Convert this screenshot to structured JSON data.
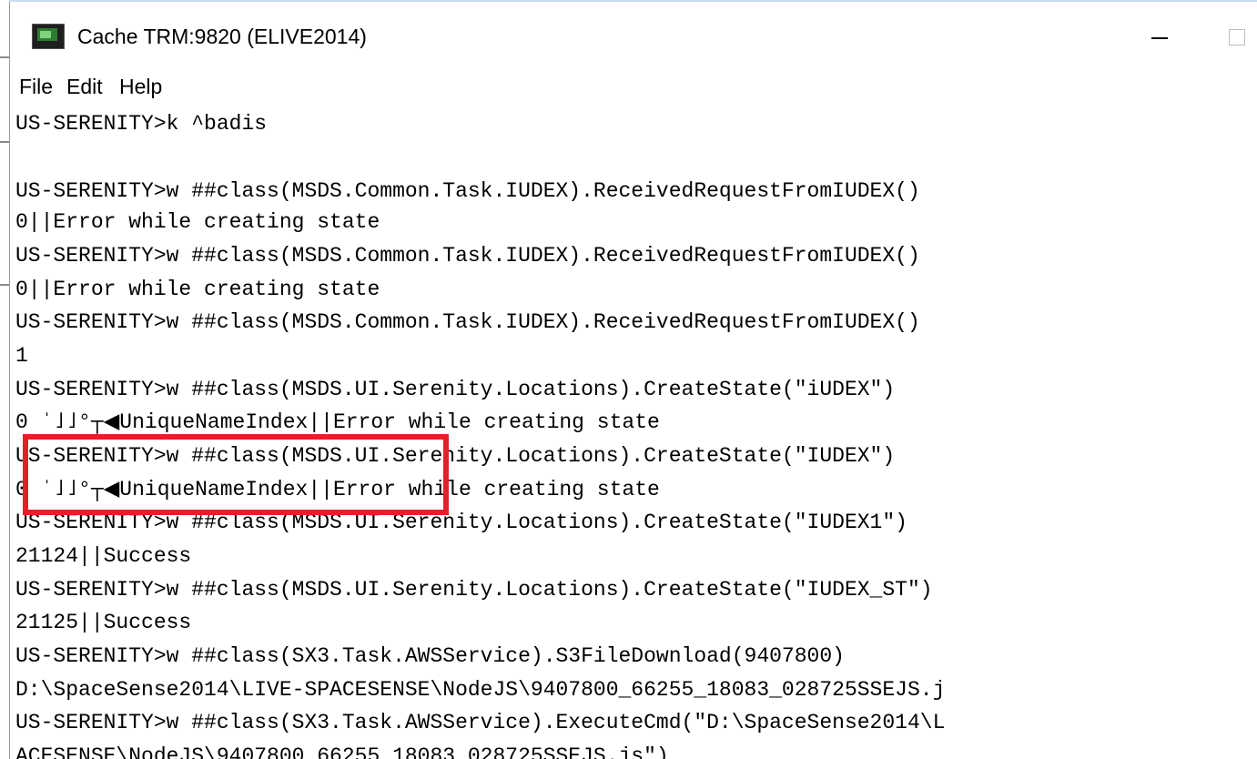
{
  "window": {
    "title": "Cache TRM:9820 (ELIVE2014)",
    "icon": "terminal-app-icon",
    "controls": {
      "minimize": "minimize-icon",
      "maximize": "maximize-icon"
    }
  },
  "menu": {
    "items": [
      {
        "label": "File"
      },
      {
        "label": "Edit"
      },
      {
        "label": "Help"
      }
    ]
  },
  "console": {
    "lines": [
      "US-SERENITY>k ^badis",
      "",
      "US-SERENITY>w ##class(MSDS.Common.Task.IUDEX).ReceivedRequestFromIUDEX()",
      "0||Error while creating state",
      "US-SERENITY>w ##class(MSDS.Common.Task.IUDEX).ReceivedRequestFromIUDEX()",
      "0||Error while creating state",
      "US-SERENITY>w ##class(MSDS.Common.Task.IUDEX).ReceivedRequestFromIUDEX()",
      "1",
      "US-SERENITY>w ##class(MSDS.UI.Serenity.Locations).CreateState(\"iUDEX\")",
      "0 ˈ˩˩°┬◀UniqueNameIndex||Error while creating state",
      "US-SERENITY>w ##class(MSDS.UI.Serenity.Locations).CreateState(\"IUDEX\")",
      "0 ˈ˩˩°┬◀UniqueNameIndex||Error while creating state",
      "US-SERENITY>w ##class(MSDS.UI.Serenity.Locations).CreateState(\"IUDEX1\")",
      "21124||Success",
      "US-SERENITY>w ##class(MSDS.UI.Serenity.Locations).CreateState(\"IUDEX_ST\")",
      "21125||Success",
      "US-SERENITY>w ##class(SX3.Task.AWSService).S3FileDownload(9407800)",
      "D:\\SpaceSense2014\\LIVE-SPACESENSE\\NodeJS\\9407800_66255_18083_028725SSEJS.j",
      "US-SERENITY>w ##class(SX3.Task.AWSService).ExecuteCmd(\"D:\\SpaceSense2014\\L",
      "ACESENSE\\NodeJS\\9407800_66255_18083_028725SSEJS.js\")"
    ]
  },
  "annotation": {
    "color": "#e2202a"
  }
}
